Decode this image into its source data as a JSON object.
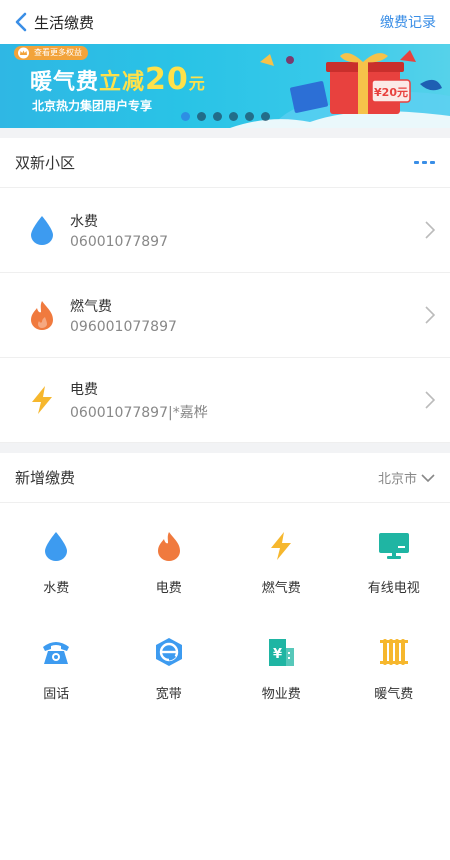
{
  "header": {
    "title": "生活缴费",
    "record_link": "缴费记录"
  },
  "banner": {
    "tag": "查看更多权益",
    "title_a": "暖气费",
    "title_b": "立减",
    "title_num": "20",
    "title_unit": "元",
    "subtitle": "北京热力集团用户专享",
    "ticket_label": "¥20元",
    "slides": 6,
    "active_slide": 0
  },
  "community": {
    "name": "双新小区",
    "bills": [
      {
        "name": "水费",
        "account": "06001077897",
        "icon": "water-drop-icon",
        "color": "#3d9bf0"
      },
      {
        "name": "燃气费",
        "account": "096001077897",
        "icon": "flame-icon",
        "color": "#f07a3e"
      },
      {
        "name": "电费",
        "account": "06001077897|*嘉桦",
        "icon": "lightning-icon",
        "color": "#f6b72d"
      }
    ]
  },
  "new_payment": {
    "title": "新增缴费",
    "city": "北京市",
    "items": [
      {
        "label": "水费",
        "icon": "water-drop-icon",
        "color": "#3d9bf0"
      },
      {
        "label": "电费",
        "icon": "flame-icon",
        "color": "#f07a3e"
      },
      {
        "label": "燃气费",
        "icon": "lightning-icon",
        "color": "#f6b72d"
      },
      {
        "label": "有线电视",
        "icon": "tv-icon",
        "color": "#1fb5a3"
      },
      {
        "label": "固话",
        "icon": "telephone-icon",
        "color": "#3d9bf0"
      },
      {
        "label": "宽带",
        "icon": "broadband-icon",
        "color": "#3d9bf0"
      },
      {
        "label": "物业费",
        "icon": "building-icon",
        "color": "#1fb5a3"
      },
      {
        "label": "暖气费",
        "icon": "radiator-icon",
        "color": "#f6b72d"
      }
    ]
  }
}
